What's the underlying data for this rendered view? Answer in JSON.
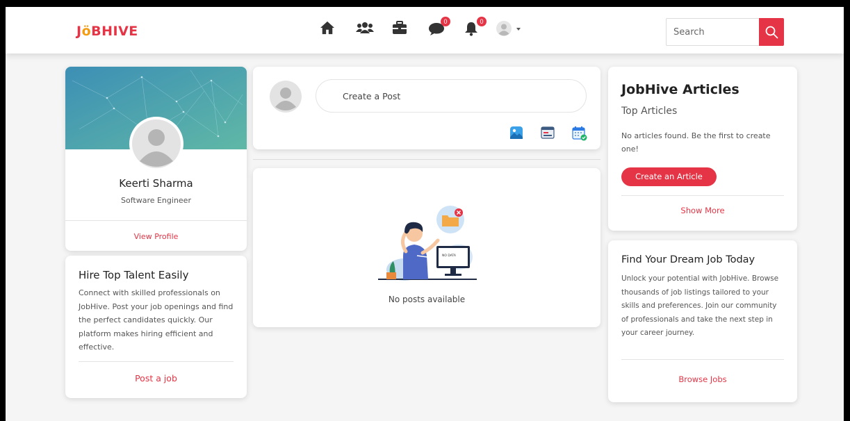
{
  "header": {
    "logo_text_1": "J",
    "logo_text_2": "ö",
    "logo_text_3": "BHIVE",
    "nav": [
      {
        "icon": "home-icon"
      },
      {
        "icon": "network-icon"
      },
      {
        "icon": "briefcase-icon"
      },
      {
        "icon": "messages-icon",
        "badge": "0"
      },
      {
        "icon": "bell-icon",
        "badge": "0"
      },
      {
        "icon": "user-avatar-icon"
      }
    ],
    "search_placeholder": "Search"
  },
  "profile": {
    "name": "Keerti Sharma",
    "role": "Software Engineer",
    "view_profile": "View Profile"
  },
  "hire": {
    "title": "Hire Top Talent Easily",
    "text": "Connect with skilled professionals on JobHive. Post your job openings and find the perfect candidates quickly. Our platform makes hiring efficient and effective.",
    "cta": "Post a job"
  },
  "post": {
    "placeholder": "Create a Post",
    "media": [
      "photo-icon",
      "layout-icon",
      "calendar-icon"
    ]
  },
  "feed": {
    "empty_label": "NO DATA",
    "empty_text": "No posts available"
  },
  "articles": {
    "title": "JobHive Articles",
    "subtitle": "Top Articles",
    "text": "No articles found. Be the first to create one!",
    "button": "Create an Article",
    "show_more": "Show More"
  },
  "dream": {
    "title": "Find Your Dream Job Today",
    "text": "Unlock your potential with JobHive. Browse thousands of job listings tailored to your skills and preferences. Join our community of professionals and take the next step in your career journey.",
    "cta": "Browse Jobs"
  },
  "colors": {
    "accent": "#e53445",
    "logo_o": "#f39c12",
    "cover_start": "#3d8fb5",
    "cover_end": "#5fb8a6"
  }
}
